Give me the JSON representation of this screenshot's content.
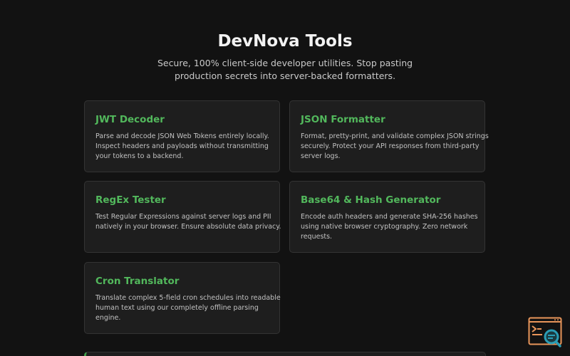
{
  "header": {
    "title": "DevNova Tools",
    "subtitle_line1": "Secure, 100% client-side developer utilities. Stop pasting",
    "subtitle_line2": "production secrets into server-backed formatters."
  },
  "tools": [
    {
      "title": "JWT Decoder",
      "desc": [
        "Parse and decode JSON Web Tokens entirely locally.",
        "Inspect headers and payloads without transmitting",
        "your tokens to a backend."
      ]
    },
    {
      "title": "JSON Formatter",
      "desc": [
        "Format, pretty-print, and validate complex JSON strings",
        "securely. Protect your API responses from third-party",
        "server logs."
      ]
    },
    {
      "title": "RegEx Tester",
      "desc": [
        "Test Regular Expressions against server logs and PII",
        "natively in your browser. Ensure absolute data privacy."
      ]
    },
    {
      "title": "Base64 & Hash Generator",
      "desc": [
        "Encode auth headers and generate SHA-256 hashes",
        "using native browser cryptography. Zero network",
        "requests."
      ]
    },
    {
      "title": "Cron Translator",
      "desc": [
        "Translate complex 5-field cron schedules into readable",
        "human text using our completely offline parsing",
        "engine."
      ]
    }
  ],
  "floating_button": {
    "icon": "terminal-search-icon"
  },
  "colors": {
    "background": "#121212",
    "card": "#1e1e1e",
    "accent": "#52b85c",
    "fab_orange": "#e8955a",
    "fab_teal": "#2a9db5"
  }
}
